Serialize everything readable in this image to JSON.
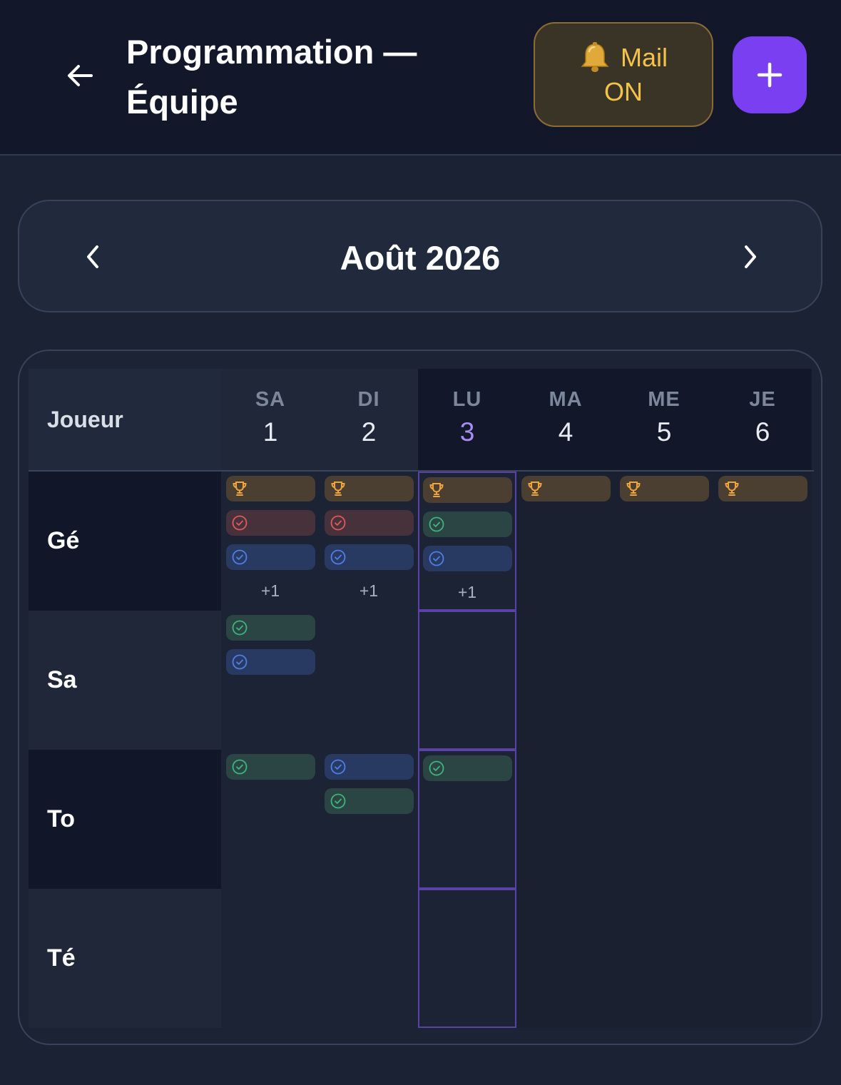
{
  "header": {
    "title_line1": "Programmation —",
    "title_line2": "Équipe",
    "mail_label": "Mail",
    "mail_state": "ON",
    "mail_icon": "bell-icon",
    "add_icon": "plus-icon",
    "back_icon": "arrow-left-icon"
  },
  "month_nav": {
    "title": "Août 2026",
    "prev_icon": "chevron-left-icon",
    "next_icon": "chevron-right-icon"
  },
  "grid": {
    "player_column_label": "Joueur",
    "days": [
      {
        "dow": "SA",
        "num": "1"
      },
      {
        "dow": "DI",
        "num": "2"
      },
      {
        "dow": "LU",
        "num": "3",
        "today": true
      },
      {
        "dow": "MA",
        "num": "4"
      },
      {
        "dow": "ME",
        "num": "5"
      },
      {
        "dow": "JE",
        "num": "6"
      }
    ],
    "players": [
      {
        "name": "Gé",
        "cells": [
          {
            "events": [
              "trophy",
              "red",
              "blue"
            ],
            "more": "+1"
          },
          {
            "events": [
              "trophy",
              "red",
              "blue"
            ],
            "more": "+1"
          },
          {
            "events": [
              "trophy",
              "green",
              "blue"
            ],
            "more": "+1"
          },
          {
            "events": [
              "trophy"
            ]
          },
          {
            "events": [
              "trophy"
            ]
          },
          {
            "events": [
              "trophy"
            ]
          }
        ]
      },
      {
        "name": "Sa",
        "cells": [
          {
            "events": [
              "green",
              "blue"
            ]
          },
          {
            "events": []
          },
          {
            "events": []
          },
          {
            "events": []
          },
          {
            "events": []
          },
          {
            "events": []
          }
        ]
      },
      {
        "name": "To",
        "cells": [
          {
            "events": [
              "green"
            ]
          },
          {
            "events": [
              "blue",
              "green"
            ]
          },
          {
            "events": [
              "green"
            ]
          },
          {
            "events": []
          },
          {
            "events": []
          },
          {
            "events": []
          }
        ]
      },
      {
        "name": "Té",
        "cells": [
          {
            "events": []
          },
          {
            "events": []
          },
          {
            "events": []
          },
          {
            "events": []
          },
          {
            "events": []
          },
          {
            "events": []
          }
        ]
      }
    ],
    "colors": {
      "trophy": "#f0a53c",
      "red": "#e05a5a",
      "green": "#3fb47c",
      "blue": "#4f7fe6",
      "today": "#a98cf5"
    }
  }
}
